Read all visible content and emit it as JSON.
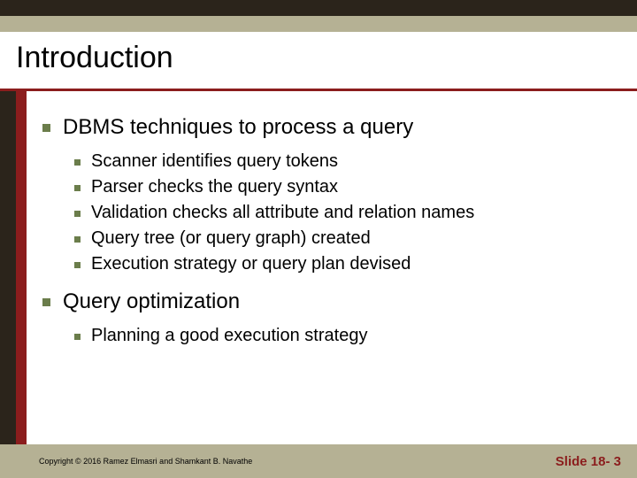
{
  "title": "Introduction",
  "bullets": [
    {
      "text": "DBMS techniques to process a query",
      "children": [
        {
          "text": "Scanner identifies query tokens"
        },
        {
          "text": "Parser checks the query syntax"
        },
        {
          "text": "Validation checks all attribute and relation names"
        },
        {
          "text": "Query tree (or query graph) created"
        },
        {
          "text": "Execution strategy or query plan devised"
        }
      ]
    },
    {
      "text": "Query optimization",
      "children": [
        {
          "text": "Planning a good execution strategy"
        }
      ]
    }
  ],
  "footer": {
    "copyright": "Copyright © 2016 Ramez Elmasri and Shamkant B. Navathe",
    "slide_number": "Slide 18- 3"
  }
}
